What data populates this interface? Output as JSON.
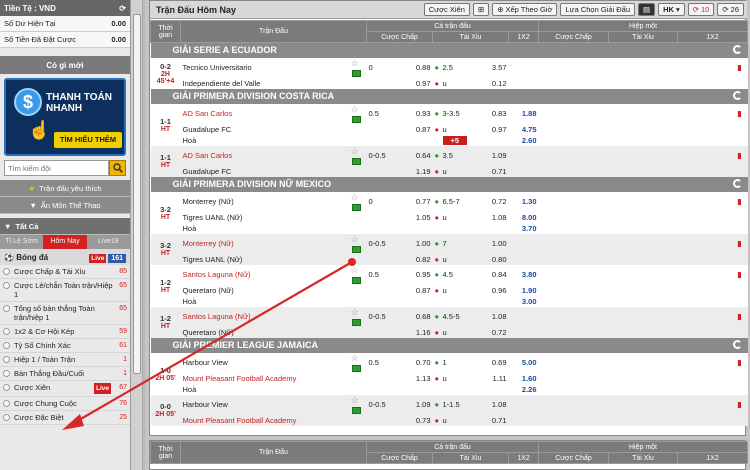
{
  "sidebar": {
    "currency_label": "Tiền Tệ : VND",
    "balance_label": "Số Dư Hiện Tại",
    "balance_value": "0.00",
    "bet_label": "Số Tiền Đã Đặt Cược",
    "bet_value": "0.00",
    "news_title": "Có gì mới",
    "banner_line1": "THANH TOÁN",
    "banner_line2": "NHANH",
    "banner_cta": "TÌM HIỂU THÊM",
    "search_placeholder": "Tìm kiếm đội",
    "favorite_label": "Trận đấu yêu thích",
    "hide_sport_label": "Ẩn Môn Thể Thao",
    "all_label": "Tất Cả",
    "tabs": [
      {
        "label": "Tỉ Lệ Sớm"
      },
      {
        "label": "Hôm Nay"
      },
      {
        "label": "Live18"
      }
    ],
    "sport": {
      "label": "Bóng đá",
      "live": "Live",
      "count": "161"
    },
    "bet_types": [
      {
        "label": "Cược Chấp & Tài Xỉu",
        "count": "85"
      },
      {
        "label": "Cược Lẻ/chẵn Toàn trận/Hiệp 1",
        "count": "65"
      },
      {
        "label": "Tổng số bàn thắng Toàn trận/hiệp 1",
        "count": "65"
      },
      {
        "label": "1x2 & Cơ Hội Kép",
        "count": "59"
      },
      {
        "label": "Tỷ Số Chính Xác",
        "count": "61"
      },
      {
        "label": "Hiệp 1 / Toàn Trận",
        "count": "1"
      },
      {
        "label": "Bàn Thắng Đầu/Cuối",
        "count": "1"
      },
      {
        "label": "Cược Xiên",
        "count": "67",
        "live": "Live"
      },
      {
        "label": "Cược Chung Cuộc",
        "count": "76"
      },
      {
        "label": "Cược Đặc Biệt",
        "count": "25"
      }
    ]
  },
  "toolbar": {
    "title": "Trận Đấu Hôm Nay",
    "parlay": "Cược Xiên",
    "sort": "Xếp Theo Giờ",
    "select_league": "Lựa Chọn Giải Đấu",
    "odds_type": "HK",
    "count1": "10",
    "count2": "26"
  },
  "table": {
    "col_time": "Thời gian",
    "col_match": "Trận Đấu",
    "full_time": "Cả trận đấu",
    "half_time": "Hiệp một",
    "handicap": "Cược Chấp",
    "over_under": "Tài Xỉu",
    "one_x_two": "1X2"
  },
  "leagues": [
    {
      "name": "GIẢI SERIE A ECUADOR",
      "matches": [
        {
          "score": "0-2",
          "time": "2H 45'+4",
          "home": "Tecnico Universitario",
          "away": "Independiente del Valle",
          "hdp": "0",
          "hdp_h": "0.88",
          "hdp_a": "0.97",
          "ou": "2.5",
          "ou_u": "u",
          "ou_h": "3.57",
          "ou_a": "0.12"
        }
      ]
    },
    {
      "name": "GIẢI PRIMERA DIVISION COSTA RICA",
      "matches": [
        {
          "score": "1-1",
          "time": "HT",
          "home": "AD San Carlos",
          "away": "Guadalupe FC",
          "draw": "Hoà",
          "hdp": "0.5",
          "hdp_h": "0.93",
          "hdp_a": "0.87",
          "ou": "3-3.5",
          "ou_u": "u",
          "ou_h": "0.83",
          "ou_a": "0.97",
          "x1": "1.88",
          "x2": "4.75",
          "xd": "2.60",
          "plus": "+5"
        },
        {
          "score": "1-1",
          "time": "HT",
          "home": "AD San Carlos",
          "away": "Guadalupe FC",
          "hdp": "0-0.5",
          "hdp_h": "0.64",
          "hdp_a": "1.19",
          "ou": "3.5",
          "ou_u": "u",
          "ou_h": "1.09",
          "ou_a": "0.71"
        }
      ]
    },
    {
      "name": "GIẢI PRIMERA DIVISION NỮ MEXICO",
      "matches": [
        {
          "score": "3-2",
          "time": "HT",
          "home": "Monterrey (Nữ)",
          "away": "Tigres UANL (Nữ)",
          "draw": "Hoà",
          "hdp": "0",
          "hdp_h": "0.77",
          "hdp_a": "1.05",
          "ou": "6.5-7",
          "ou_u": "u",
          "ou_h": "0.72",
          "ou_a": "1.08",
          "x1": "1.30",
          "x2": "8.00",
          "xd": "3.70"
        },
        {
          "score": "3-2",
          "time": "HT",
          "home": "Monterrey (Nữ)",
          "away": "Tigres UANL (Nữ)",
          "hdp": "0-0.5",
          "hdp_h": "1.00",
          "hdp_a": "0.82",
          "ou": "7",
          "ou_u": "u",
          "ou_h": "1.00",
          "ou_a": "0.80"
        },
        {
          "score": "1-2",
          "time": "HT",
          "home": "Santos Laguna (Nữ)",
          "away": "Queretaro (Nữ)",
          "draw": "Hoà",
          "hdp": "0.5",
          "hdp_h": "0.95",
          "hdp_a": "0.87",
          "ou": "4.5",
          "ou_u": "u",
          "ou_h": "0.84",
          "ou_a": "0.96",
          "x1": "3.80",
          "x2": "1.90",
          "xd": "3.00"
        },
        {
          "score": "1-2",
          "time": "HT",
          "home": "Santos Laguna (Nữ)",
          "away": "Queretaro (Nữ)",
          "hdp": "0-0.5",
          "hdp_h": "0.68",
          "hdp_a": "1.16",
          "ou": "4.5-5",
          "ou_u": "u",
          "ou_h": "1.08",
          "ou_a": "0.72"
        }
      ]
    },
    {
      "name": "GIẢI PREMIER LEAGUE JAMAICA",
      "matches": [
        {
          "score": "1-0",
          "time": "2H 05'",
          "home": "Harbour View",
          "away": "Mount Pleasant Football Academy",
          "draw": "Hoà",
          "hdp": "0.5",
          "hdp_h": "0.70",
          "hdp_a": "1.13",
          "ou": "1",
          "ou_u": "u",
          "ou_h": "0.69",
          "ou_a": "1.11",
          "x1": "5.00",
          "x2": "1.60",
          "xd": "2.26"
        },
        {
          "score": "0-0",
          "time": "2H 05'",
          "home": "Harbour View",
          "away": "Mount Pleasant Football Academy",
          "hdp": "0-0.5",
          "hdp_h": "1.09",
          "hdp_a": "0.73",
          "ou": "1-1.5",
          "ou_u": "u",
          "ou_h": "1.08",
          "ou_a": "0.71"
        }
      ]
    }
  ],
  "colors": {
    "accent": "#d32020",
    "header": "#7b7b7b",
    "blue": "#1a4aa8"
  }
}
